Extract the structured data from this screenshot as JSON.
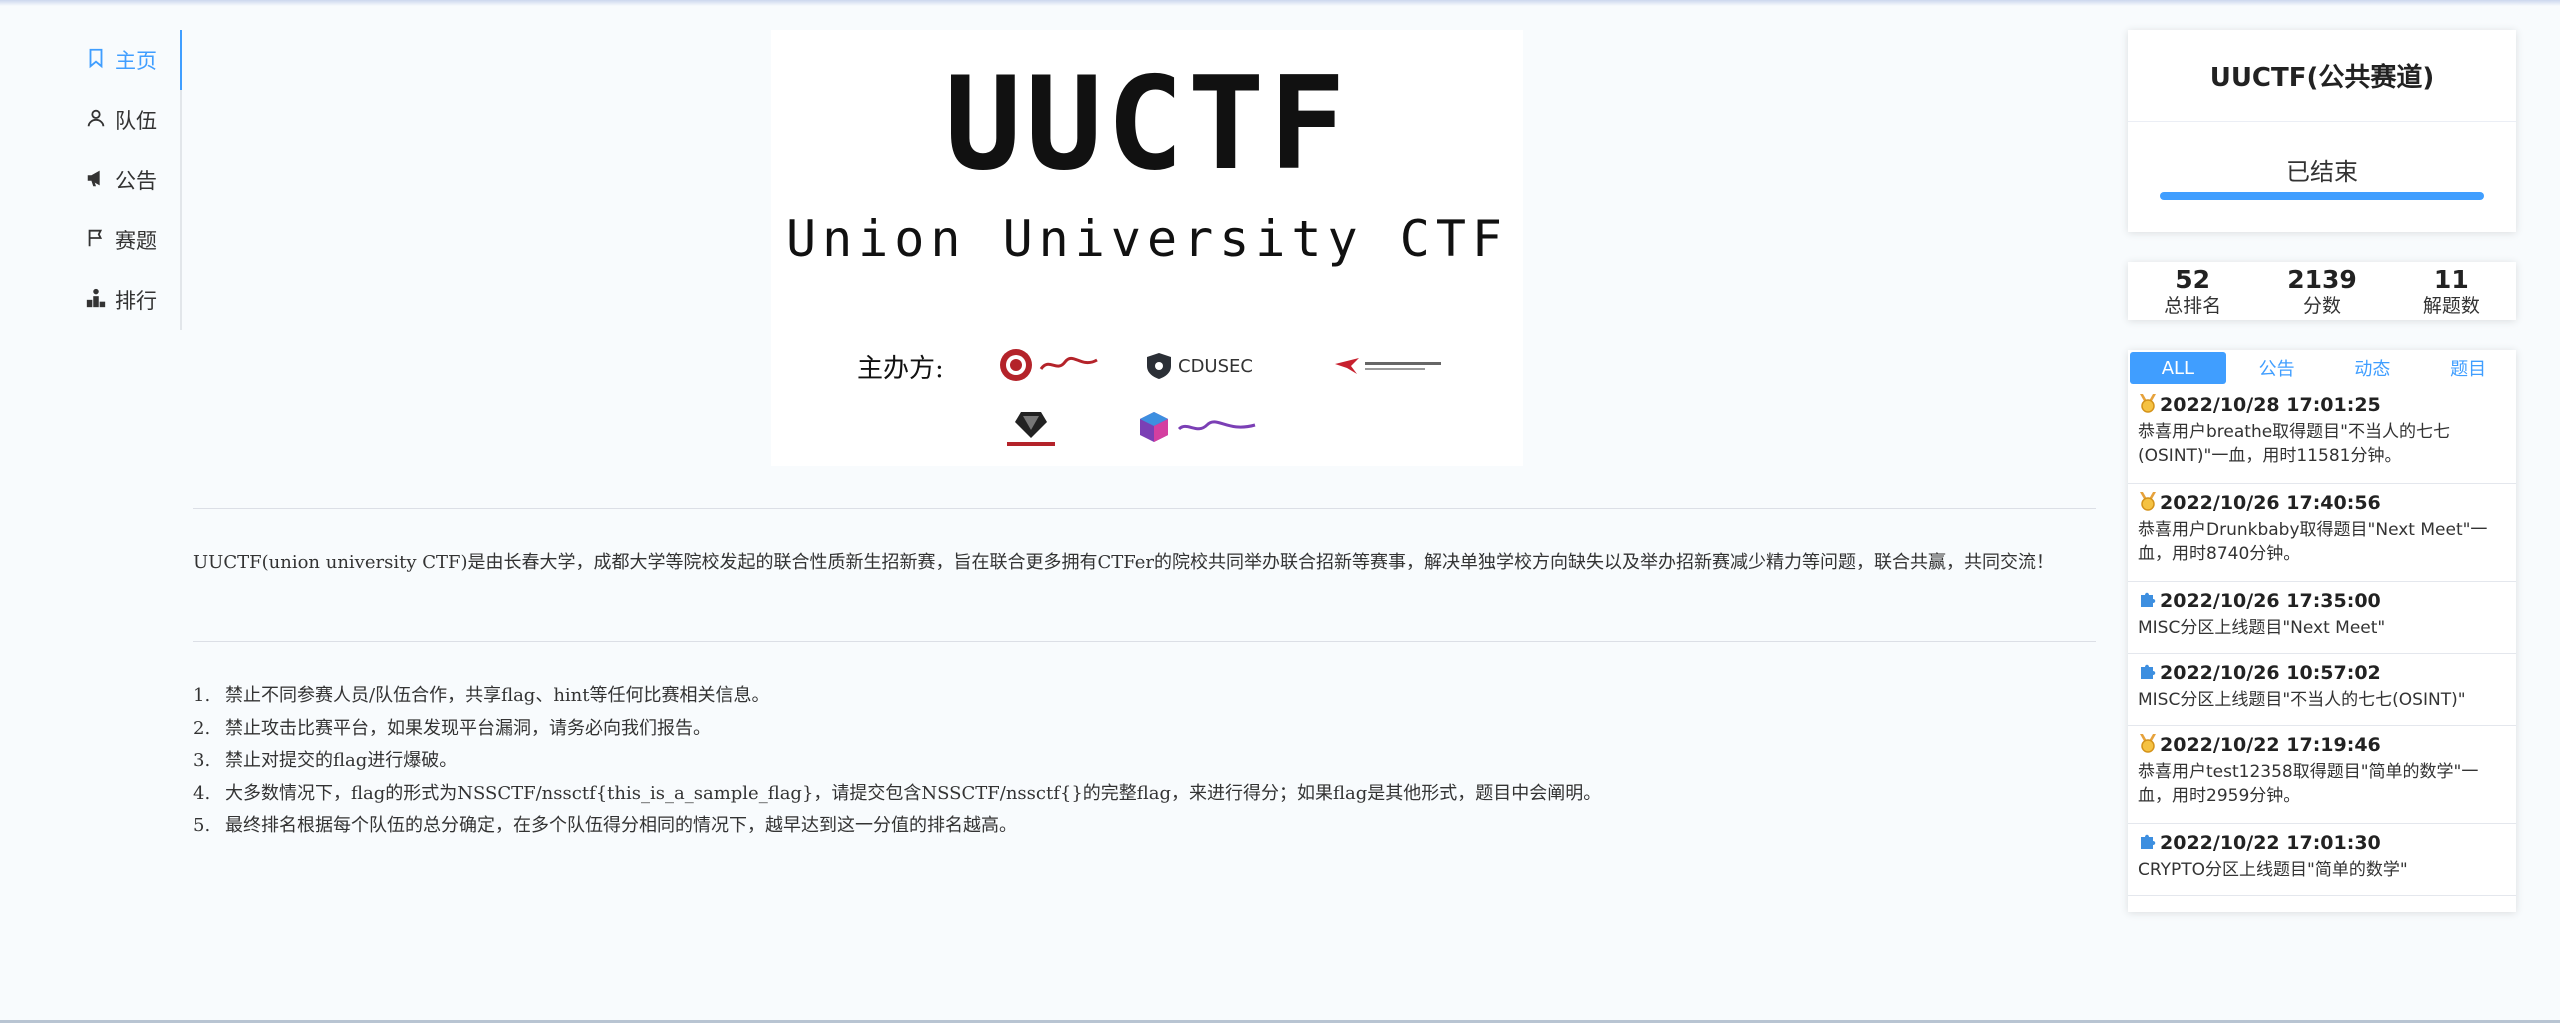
{
  "sidebar": {
    "items": [
      {
        "label": "主页",
        "icon": "bookmark-icon"
      },
      {
        "label": "队伍",
        "icon": "user-icon"
      },
      {
        "label": "公告",
        "icon": "megaphone-icon"
      },
      {
        "label": "赛题",
        "icon": "flag-icon"
      },
      {
        "label": "排行",
        "icon": "podium-icon"
      }
    ],
    "active_index": 0
  },
  "banner": {
    "title": "UUCTF",
    "subtitle": "Union University CTF",
    "organizer_label": "主办方:",
    "logos": [
      {
        "name": "changchun-university-logo"
      },
      {
        "name": "cdusec-logo",
        "text": "CDUSEC"
      },
      {
        "name": "airplane-college-logo"
      },
      {
        "name": "shield-team-logo"
      },
      {
        "name": "cube-team-logo"
      }
    ]
  },
  "main": {
    "intro": "UUCTF(union university CTF)是由长春大学，成都大学等院校发起的联合性质新生招新赛，旨在联合更多拥有CTFer的院校共同举办联合招新等赛事，解决单独学校方向缺失以及举办招新赛减少精力等问题，联合共赢，共同交流！",
    "rules": [
      {
        "num": "1.",
        "text": "禁止不同参赛人员/队伍合作，共享flag、hint等任何比赛相关信息。"
      },
      {
        "num": "2.",
        "text": "禁止攻击比赛平台，如果发现平台漏洞，请务必向我们报告。"
      },
      {
        "num": "3.",
        "text": "禁止对提交的flag进行爆破。"
      },
      {
        "num": "4.",
        "text": "大多数情况下，flag的形式为NSSCTF/nssctf{this_is_a_sample_flag}，请提交包含NSSCTF/nssctf{}的完整flag，来进行得分；如果flag是其他形式，题目中会阐明。"
      },
      {
        "num": "5.",
        "text": "最终排名根据每个队伍的总分确定，在多个队伍得分相同的情况下，越早达到这一分值的排名越高。"
      }
    ]
  },
  "status": {
    "title": "UUCTF(公共赛道)",
    "state": "已结束",
    "progress": 1.0,
    "accent": "#409eff"
  },
  "stats": [
    {
      "value": "52",
      "label": "总排名"
    },
    {
      "value": "2139",
      "label": "分数"
    },
    {
      "value": "11",
      "label": "解题数"
    }
  ],
  "feed": {
    "tabs": [
      "ALL",
      "公告",
      "动态",
      "题目"
    ],
    "active_tab": 0,
    "items": [
      {
        "icon": "medal-icon",
        "time": "2022/10/28 17:01:25",
        "text": "恭喜用户breathe取得题目\"不当人的七七(OSINT)\"一血，用时11581分钟。"
      },
      {
        "icon": "medal-icon",
        "time": "2022/10/26 17:40:56",
        "text": "恭喜用户Drunkbaby取得题目\"Next Meet\"一血，用时8740分钟。"
      },
      {
        "icon": "puzzle-icon",
        "time": "2022/10/26 17:35:00",
        "text": "MISC分区上线题目\"Next Meet\""
      },
      {
        "icon": "puzzle-icon",
        "time": "2022/10/26 10:57:02",
        "text": "MISC分区上线题目\"不当人的七七(OSINT)\""
      },
      {
        "icon": "medal-icon",
        "time": "2022/10/22 17:19:46",
        "text": "恭喜用户test12358取得题目\"简单的数学\"一血，用时2959分钟。"
      },
      {
        "icon": "puzzle-icon",
        "time": "2022/10/22 17:01:30",
        "text": "CRYPTO分区上线题目\"简单的数学\""
      }
    ]
  }
}
